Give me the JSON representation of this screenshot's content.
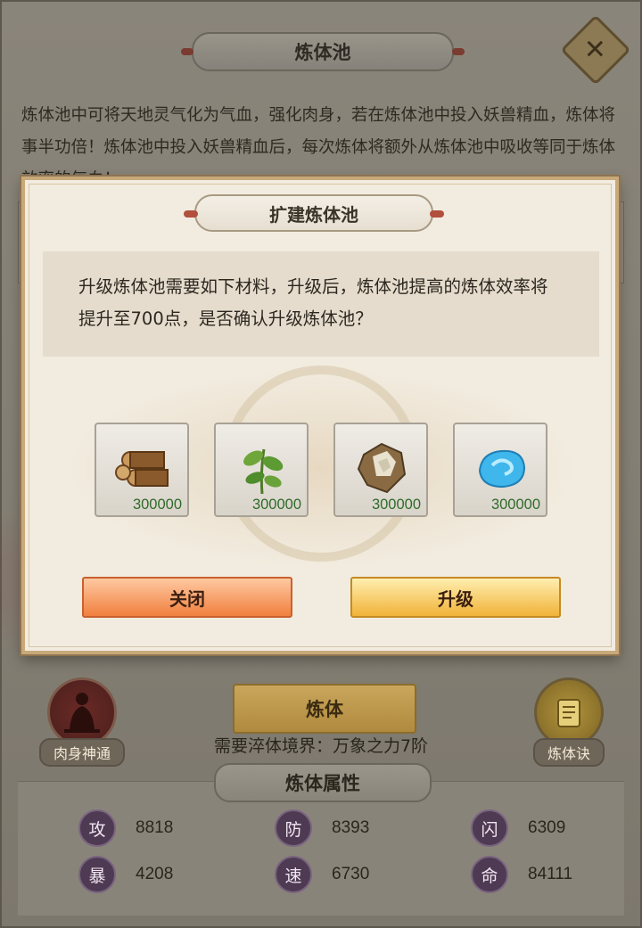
{
  "background": {
    "title": "炼体池",
    "close_icon": "close-x-icon",
    "description": "炼体池中可将天地灵气化为气血，强化肉身，若在炼体池中投入妖兽精血，炼体将事半功倍！炼体池中投入妖兽精血后，每次炼体将额外从炼体池中吸收等同于炼体效率的气血！",
    "left_button": {
      "label": "肉身神通",
      "icon": "buddha-figure-icon"
    },
    "right_button": {
      "label": "炼体诀",
      "icon": "scroll-book-icon"
    },
    "main_button": {
      "label": "炼体"
    },
    "requirement": "需要淬体境界：万象之力7阶",
    "attributes_title": "炼体属性",
    "attributes": [
      {
        "badge": "攻",
        "value": "8818"
      },
      {
        "badge": "防",
        "value": "8393"
      },
      {
        "badge": "闪",
        "value": "6309"
      },
      {
        "badge": "暴",
        "value": "4208"
      },
      {
        "badge": "速",
        "value": "6730"
      },
      {
        "badge": "命",
        "value": "84111"
      }
    ]
  },
  "modal": {
    "title": "扩建炼体池",
    "message": "升级炼体池需要如下材料，升级后，炼体池提高的炼体效率将提升至700点，是否确认升级炼体池？",
    "materials": [
      {
        "icon": "wood-logs-icon",
        "quantity": "300000"
      },
      {
        "icon": "herb-plant-icon",
        "quantity": "300000"
      },
      {
        "icon": "ore-stone-icon",
        "quantity": "300000"
      },
      {
        "icon": "blue-crystal-icon",
        "quantity": "300000"
      }
    ],
    "close_button": "关闭",
    "upgrade_button": "升级"
  },
  "colors": {
    "modal_bg": "#f2ece0",
    "close_button": "#f0803f",
    "upgrade_button": "#f1b338",
    "quantity_text": "#2f6b2a"
  }
}
